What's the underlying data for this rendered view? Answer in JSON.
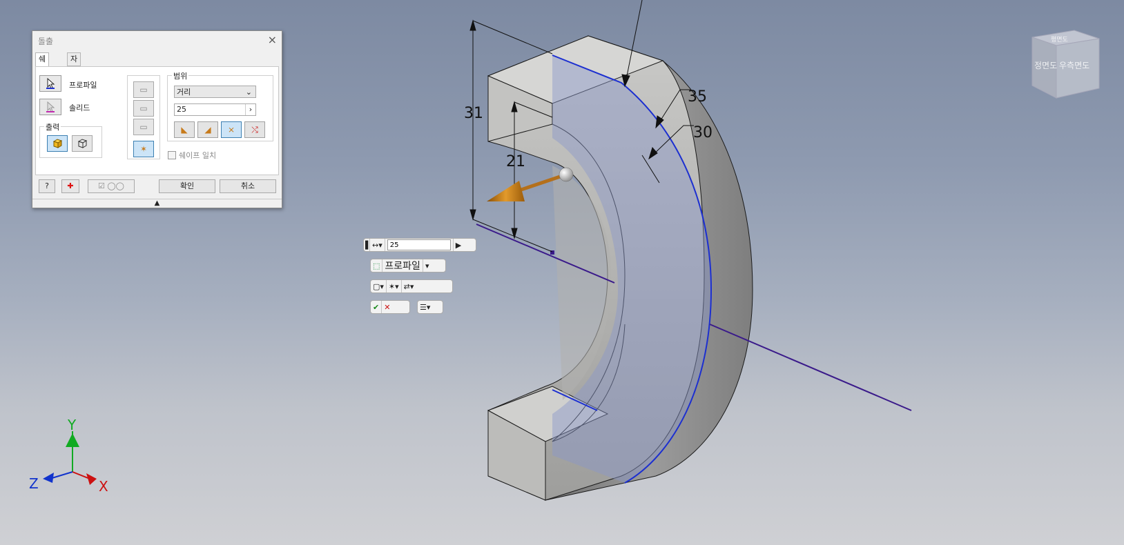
{
  "dialog": {
    "title": "돌출",
    "close_glyph": "×",
    "tabs": [
      {
        "label": "쉐이프"
      },
      {
        "label": "자세히"
      }
    ],
    "profile_label": "프로파일",
    "solid_label": "솔리드",
    "output_group": "출력",
    "range_group": "범위",
    "range_type": "거리",
    "distance_value": "25",
    "match_shape_label": "쉐이프 일치",
    "ok_label": "확인",
    "cancel_label": "취소",
    "collapse_glyph": "▲"
  },
  "mini_toolbar": {
    "distance_value": "25",
    "profile_label": "프로파일"
  },
  "dimensions": {
    "d31": "31",
    "d21": "21",
    "d35": "35",
    "d30": "30"
  },
  "viewcube": {
    "front": "정면도",
    "right": "우측면도",
    "top": "평면도"
  },
  "axes": {
    "x": "X",
    "y": "Y",
    "z": "Z"
  },
  "colors": {
    "accent_blue": "#1c2fd0",
    "arrow_orange": "#c77a1a",
    "axis_x": "#cc1111",
    "axis_y": "#11aa22",
    "axis_z": "#1133cc"
  }
}
